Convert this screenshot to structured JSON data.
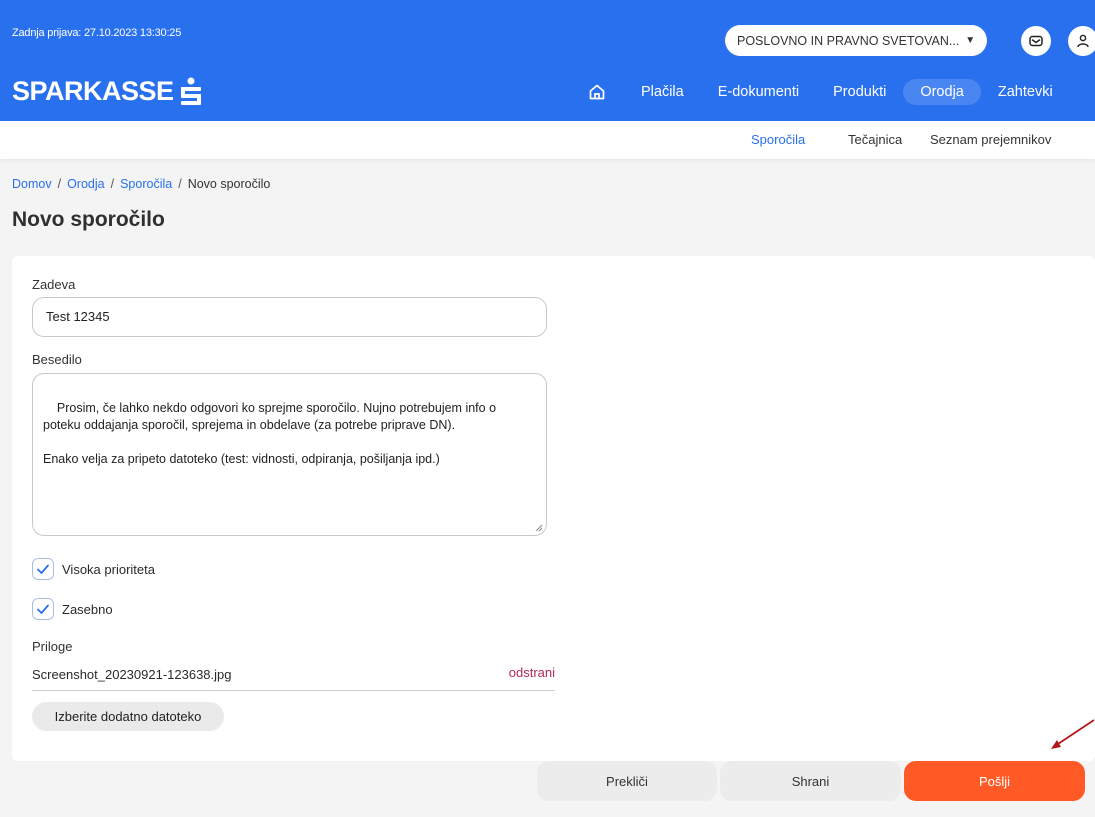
{
  "header": {
    "last_login": "Zadnja prijava: 27.10.2023 13:30:25",
    "account_select": "POSLOVNO IN PRAVNO SVETOVAN...",
    "logo_text": "SPARKASSE"
  },
  "nav": {
    "items": [
      "Plačila",
      "E-dokumenti",
      "Produkti",
      "Orodja",
      "Zahtevki"
    ],
    "active": "Orodja"
  },
  "subnav": {
    "items": [
      "Sporočila",
      "Tečajnica",
      "Seznam prejemnikov"
    ],
    "active": "Sporočila"
  },
  "breadcrumb": [
    "Domov",
    "Orodja",
    "Sporočila",
    "Novo sporočilo"
  ],
  "page_title": "Novo sporočilo",
  "form": {
    "subject_label": "Zadeva",
    "subject_value": "Test 12345",
    "body_label": "Besedilo",
    "body_value": "Prosim, če lahko nekdo odgovori ko sprejme sporočilo. Nujno potrebujem info o\npoteku oddajanja sporočil, sprejema in obdelave (za potrebe priprave DN).\n\nEnako velja za pripeto datoteko (test: vidnosti, odpiranja, pošiljanja ipd.)",
    "high_priority_label": "Visoka prioriteta",
    "high_priority_checked": true,
    "private_label": "Zasebno",
    "private_checked": true,
    "attachments_label": "Priloge",
    "attachment_name": "Screenshot_20230921-123638.jpg",
    "remove_label": "odstrani",
    "add_file_label": "Izberite dodatno datoteko"
  },
  "actions": {
    "cancel": "Prekliči",
    "save": "Shrani",
    "send": "Pošlji"
  },
  "colors": {
    "brand_blue": "#2870ed",
    "send_orange": "#ff5a26",
    "remove_link": "#b2285a",
    "annotation_arrow": "#b01818"
  }
}
